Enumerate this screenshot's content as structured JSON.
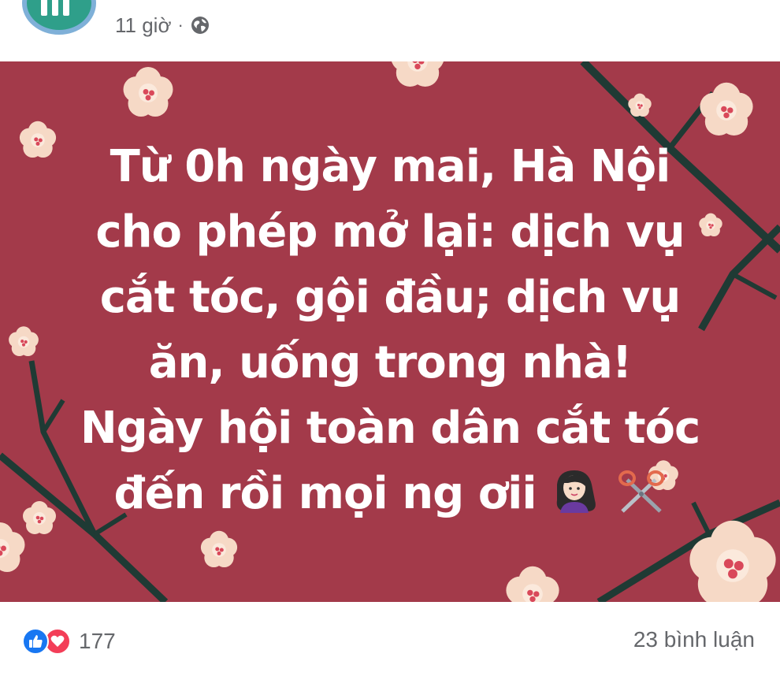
{
  "post": {
    "time": "11 giờ",
    "separator": "·",
    "privacy_icon": "globe-icon",
    "background_color": "#a33a4a",
    "text_lines": [
      "Từ 0h ngày mai, Hà Nội",
      "cho phép mở lại: dịch vụ",
      "cắt tóc, gội đầu; dịch vụ",
      "ăn, uống trong nhà!",
      "Ngày hội toàn dân cắt tóc",
      "đến rồi mọi ng ơii"
    ],
    "emojis": [
      "woman-getting-haircut-icon",
      "scissors-icon"
    ]
  },
  "footer": {
    "reaction_icons": [
      "like-icon",
      "love-icon"
    ],
    "reaction_count": "177",
    "comments": "23 bình luận"
  }
}
